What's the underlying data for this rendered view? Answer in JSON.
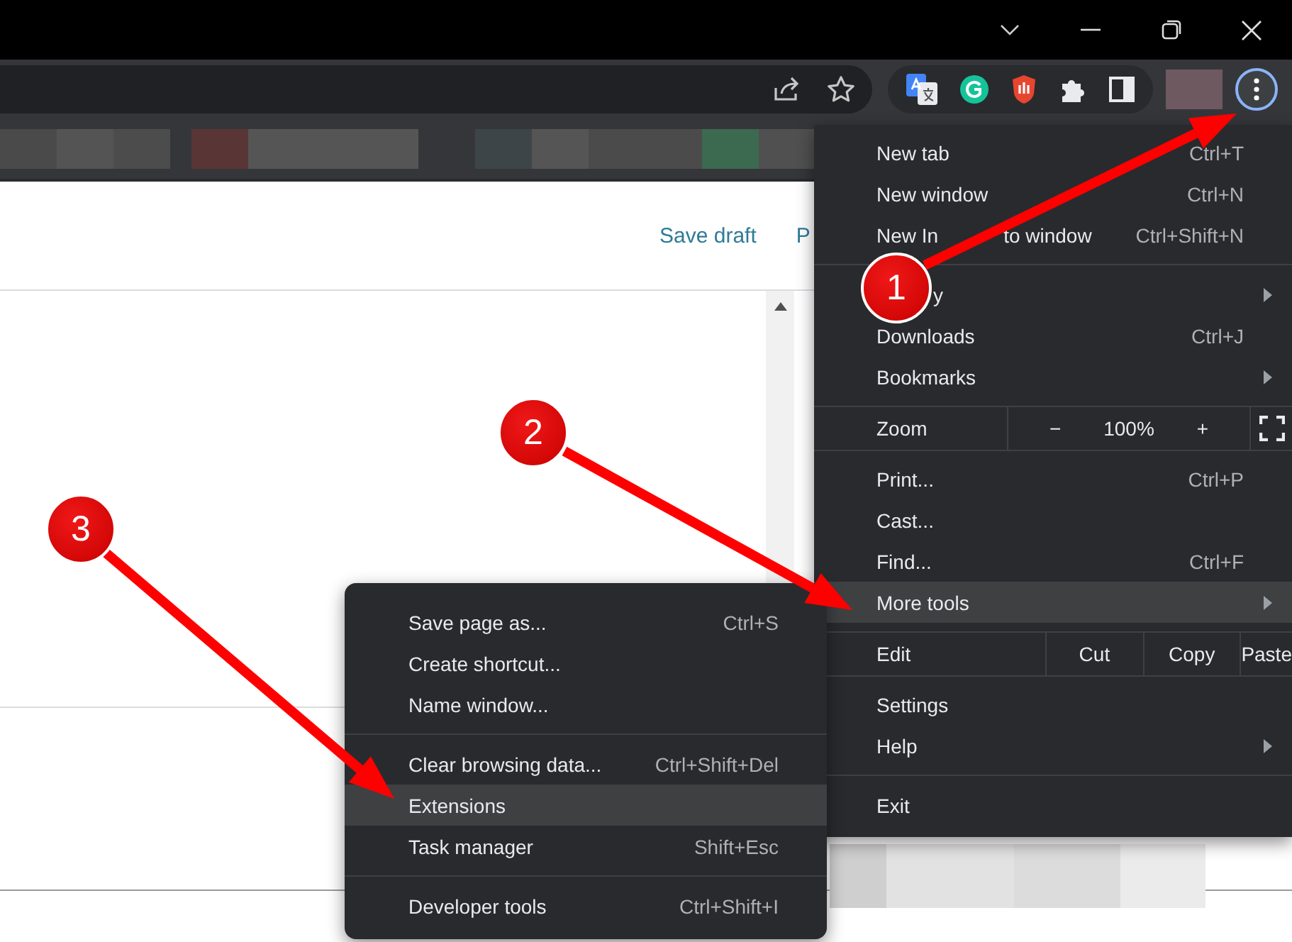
{
  "toolbar": {
    "menu_button": {
      "focused": true
    }
  },
  "page": {
    "links": [
      "Save draft",
      "P"
    ]
  },
  "menu": {
    "items": [
      {
        "kind": "item",
        "label": "New tab",
        "shortcut": "Ctrl+T",
        "submenu": false,
        "selected": false
      },
      {
        "kind": "item",
        "label": "New window",
        "shortcut": "Ctrl+N",
        "submenu": false,
        "selected": false
      },
      {
        "kind": "item",
        "label_parts": [
          "New In",
          "to window"
        ],
        "shortcut": "Ctrl+Shift+N",
        "submenu": false,
        "selected": false
      },
      {
        "kind": "separator"
      },
      {
        "kind": "item",
        "label": "y",
        "submenu": true,
        "selected": false
      },
      {
        "kind": "item",
        "label": "Downloads",
        "shortcut": "Ctrl+J",
        "submenu": false,
        "selected": false
      },
      {
        "kind": "item",
        "label": "Bookmarks",
        "submenu": true,
        "selected": false
      },
      {
        "kind": "zoom",
        "label": "Zoom",
        "minus": "−",
        "value": "100%",
        "plus": "+"
      },
      {
        "kind": "item",
        "label": "Print...",
        "shortcut": "Ctrl+P",
        "submenu": false,
        "selected": false
      },
      {
        "kind": "item",
        "label": "Cast...",
        "submenu": false,
        "selected": false
      },
      {
        "kind": "item",
        "label": "Find...",
        "shortcut": "Ctrl+F",
        "submenu": false,
        "selected": false
      },
      {
        "kind": "item",
        "label": "More tools",
        "submenu": true,
        "selected": true
      },
      {
        "kind": "edit",
        "label": "Edit",
        "buttons": [
          "Cut",
          "Copy",
          "Paste"
        ]
      },
      {
        "kind": "item",
        "label": "Settings",
        "submenu": false,
        "selected": false
      },
      {
        "kind": "item",
        "label": "Help",
        "submenu": true,
        "selected": false
      },
      {
        "kind": "separator"
      },
      {
        "kind": "item",
        "label": "Exit",
        "submenu": false,
        "selected": false
      }
    ]
  },
  "submenu": {
    "items": [
      {
        "kind": "item",
        "label": "Save page as...",
        "shortcut": "Ctrl+S",
        "selected": false
      },
      {
        "kind": "item",
        "label": "Create shortcut...",
        "selected": false
      },
      {
        "kind": "item",
        "label": "Name window...",
        "selected": false
      },
      {
        "kind": "separator"
      },
      {
        "kind": "item",
        "label": "Clear browsing data...",
        "shortcut": "Ctrl+Shift+Del",
        "selected": false
      },
      {
        "kind": "item",
        "label": "Extensions",
        "selected": true
      },
      {
        "kind": "item",
        "label": "Task manager",
        "shortcut": "Shift+Esc",
        "selected": false
      },
      {
        "kind": "separator"
      },
      {
        "kind": "item",
        "label": "Developer tools",
        "shortcut": "Ctrl+Shift+I",
        "selected": false
      }
    ]
  },
  "annotations": [
    {
      "number": "1"
    },
    {
      "number": "2"
    },
    {
      "number": "3"
    }
  ]
}
